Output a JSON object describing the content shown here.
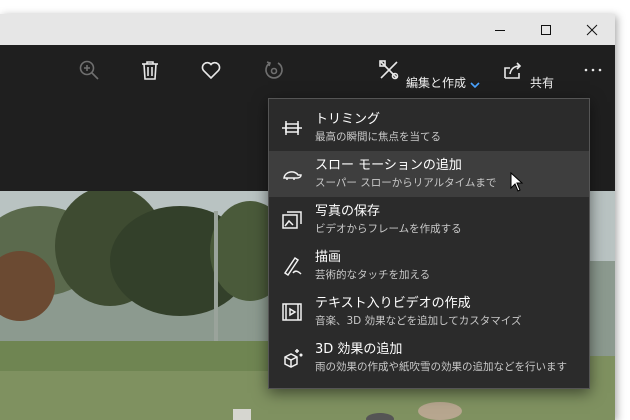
{
  "toolbar": {
    "zoom_icon": "zoom-in-icon",
    "delete_icon": "trash-icon",
    "favorite_icon": "heart-icon",
    "rotate_icon": "rotate-icon",
    "edit_label": "編集と作成",
    "share_label": "共有",
    "more_label": "…"
  },
  "menu": {
    "items": [
      {
        "icon": "trim-icon",
        "title": "トリミング",
        "subtitle": "最高の瞬間に焦点を当てる"
      },
      {
        "icon": "slow-motion-icon",
        "title": "スロー モーションの追加",
        "subtitle": "スーパー スローからリアルタイムまで"
      },
      {
        "icon": "save-photo-icon",
        "title": "写真の保存",
        "subtitle": "ビデオからフレームを作成する"
      },
      {
        "icon": "draw-icon",
        "title": "描画",
        "subtitle": "芸術的なタッチを加える"
      },
      {
        "icon": "text-video-icon",
        "title": "テキスト入りビデオの作成",
        "subtitle": "音楽、3D 効果などを追加してカスタマイズ"
      },
      {
        "icon": "3d-effects-icon",
        "title": "3D 効果の追加",
        "subtitle": "雨の効果の作成や紙吹雪の効果の追加などを行います"
      }
    ],
    "hovered_index": 1
  },
  "colors": {
    "toolbar_bg": "#1f1f1f",
    "menu_bg": "#2b2b2b",
    "menu_hover": "#3e3e3e",
    "accent": "#4aa3ff"
  }
}
